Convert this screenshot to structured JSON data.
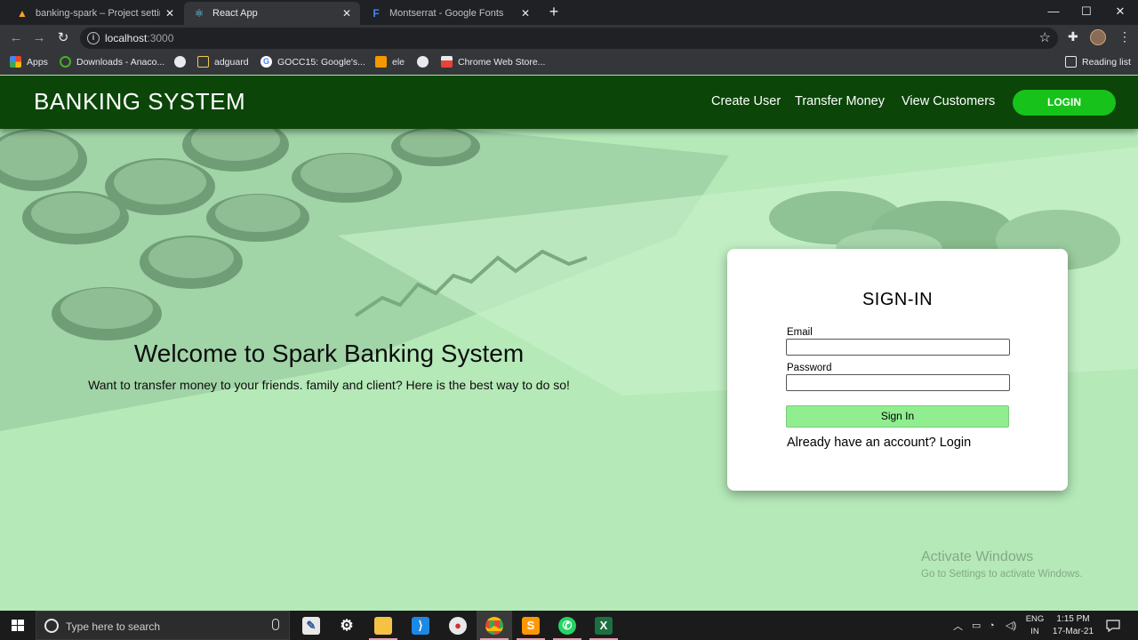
{
  "browser": {
    "tabs": [
      {
        "title": "banking-spark – Project settings",
        "icon": "firebase-icon",
        "active": false
      },
      {
        "title": "React App",
        "icon": "react-icon",
        "active": true
      },
      {
        "title": "Montserrat - Google Fonts",
        "icon": "google-fonts-icon",
        "active": false
      }
    ],
    "close_glyph": "✕",
    "new_tab_glyph": "+",
    "window_controls": [
      "—",
      "☐",
      "✕"
    ],
    "url_host": "localhost",
    "url_port": ":3000",
    "bookmarks": [
      {
        "label": "Apps",
        "icon": "apps-grid-icon"
      },
      {
        "label": "Downloads - Anaco...",
        "icon": "anaconda-icon"
      },
      {
        "label": "",
        "icon": "globe-icon"
      },
      {
        "label": "adguard",
        "icon": "bookmark-icon"
      },
      {
        "label": "GOCC15: Google's...",
        "icon": "google-icon"
      },
      {
        "label": "ele",
        "icon": "bookmark-icon"
      },
      {
        "label": "",
        "icon": "globe-icon"
      },
      {
        "label": "Chrome Web Store...",
        "icon": "chrome-web-store-icon"
      }
    ],
    "reading_list": "Reading list"
  },
  "app": {
    "brand": "BANKING SYSTEM",
    "nav": [
      "Create User",
      "Transfer Money",
      "View Customers"
    ],
    "login_button": "LOGIN",
    "accent_color": "#17c21a",
    "nav_bg_color": "#0b4608",
    "welcome_title": "Welcome to Spark Banking System",
    "welcome_subtitle": "Want to transfer money to your friends. family and client? Here is the best way to do so!",
    "signin": {
      "title": "SIGN-IN",
      "email_label": "Email",
      "email_value": "",
      "password_label": "Password",
      "password_value": "",
      "button": "Sign In",
      "already": "Already have an account? Login"
    }
  },
  "watermark": {
    "line1": "Activate Windows",
    "line2": "Go to Settings to activate Windows."
  },
  "taskbar": {
    "search_placeholder": "Type here to search",
    "apps": [
      "file-explorer-editor-icon",
      "settings-icon",
      "folder-icon",
      "vscode-icon",
      "paint-icon",
      "chrome-icon",
      "sublime-icon",
      "whatsapp-icon",
      "excel-icon"
    ],
    "lang_line1": "ENG",
    "lang_line2": "IN",
    "time": "1:15 PM",
    "date": "17-Mar-21"
  }
}
